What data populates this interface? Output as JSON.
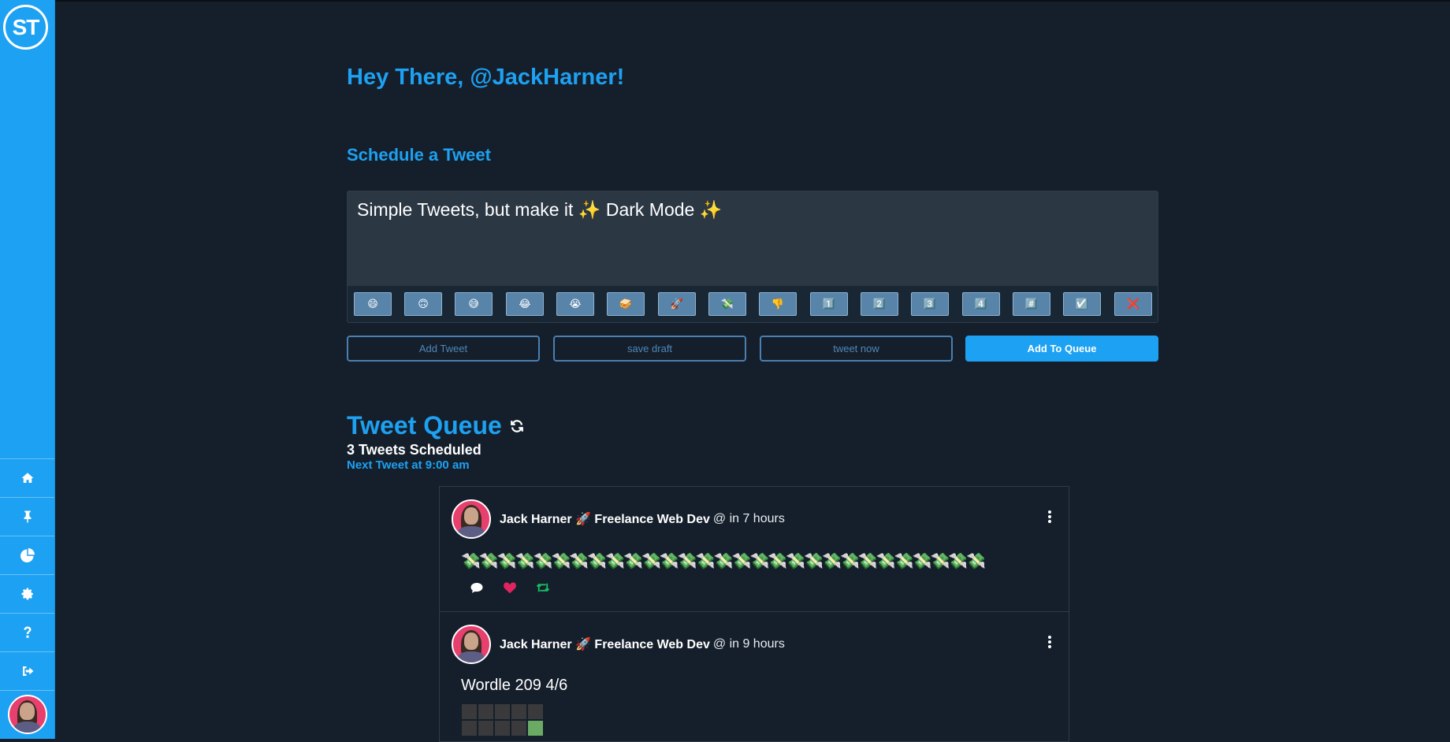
{
  "app": {
    "logo_text": "ST"
  },
  "sidebar": {
    "items": [
      {
        "icon": "home-icon"
      },
      {
        "icon": "pin-icon"
      },
      {
        "icon": "pie-chart-icon"
      },
      {
        "icon": "gear-icon"
      },
      {
        "icon": "question-icon"
      },
      {
        "icon": "logout-icon"
      }
    ]
  },
  "header": {
    "greeting": "Hey There, @JackHarner!"
  },
  "composer": {
    "title": "Schedule a Tweet",
    "text": "Simple Tweets, but make it ✨ Dark Mode ✨",
    "emojis": [
      "😄",
      "🙃",
      "😅",
      "😂",
      "😭",
      "🥪",
      "🚀",
      "💸",
      "👎",
      "1️⃣",
      "2️⃣",
      "3️⃣",
      "4️⃣",
      "#️⃣",
      "☑️",
      "❌"
    ]
  },
  "buttons": {
    "add_tweet": "Add Tweet",
    "save_draft": "save draft",
    "tweet_now": "tweet now",
    "add_to_queue": "Add To Queue"
  },
  "queue": {
    "title": "Tweet Queue",
    "count": "3 Tweets Scheduled",
    "next": "Next Tweet at 9:00 am"
  },
  "tweets": [
    {
      "author": "Jack Harner 🚀 Freelance Web Dev",
      "time": "@ in 7 hours",
      "text": "💸💸💸💸💸💸💸💸💸💸💸💸💸💸💸💸💸💸💸💸💸💸💸💸💸💸💸💸💸"
    },
    {
      "author": "Jack Harner 🚀 Freelance Web Dev",
      "time": "@ in 9 hours",
      "text": "Wordle 209 4/6"
    }
  ],
  "colors": {
    "background": "#151f2b",
    "accent": "#1da1f2",
    "composer": "#2c3744",
    "reply": "#ffffff",
    "like": "#e0245e",
    "retweet": "#17bf63"
  }
}
